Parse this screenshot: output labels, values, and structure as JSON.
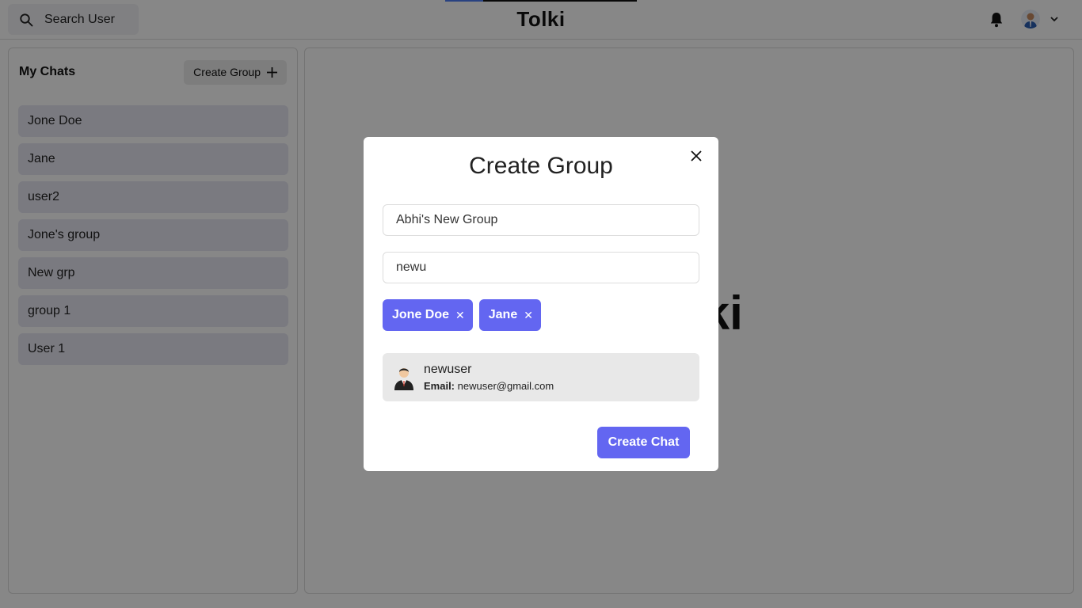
{
  "header": {
    "search_label": "Search User",
    "app_title": "Tolki",
    "progress_fraction": 0.2
  },
  "sidebar": {
    "title": "My Chats",
    "create_group_label": "Create Group",
    "chats": [
      "Jone Doe",
      "Jane",
      "user2",
      "Jone's group",
      "New grp",
      "group 1",
      "User 1"
    ]
  },
  "main": {
    "watermark_text": "Tolki"
  },
  "modal": {
    "title": "Create Group",
    "group_name_value": "Abhi's New Group",
    "user_search_value": "newu",
    "selected_users": [
      "Jone Doe",
      "Jane"
    ],
    "chip_remove_glyph": "✕",
    "search_result": {
      "name": "newuser",
      "email_label": "Email:",
      "email": "newuser@gmail.com"
    },
    "submit_label": "Create Chat"
  },
  "colors": {
    "accent": "#6366f1",
    "chat_item_bg": "#e6e6f2",
    "overlay": "rgba(0,0,0,0.47)"
  },
  "icons": [
    "search-icon",
    "bell-icon",
    "chevron-down-icon",
    "plus-icon",
    "close-icon",
    "user-avatar-icon"
  ]
}
